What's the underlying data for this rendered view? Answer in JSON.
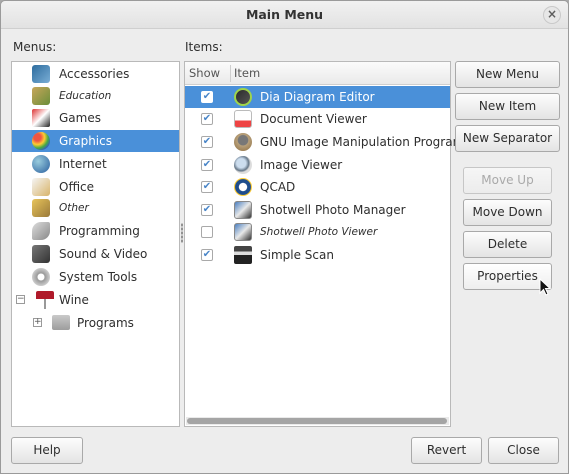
{
  "window": {
    "title": "Main Menu"
  },
  "labels": {
    "menus": "Menus:",
    "items": "Items:"
  },
  "menus": [
    {
      "label": "Accessories",
      "icon": "accessories-icon",
      "style": "normal",
      "selected": false
    },
    {
      "label": "Education",
      "icon": "education-icon",
      "style": "hidden",
      "selected": false
    },
    {
      "label": "Games",
      "icon": "games-icon",
      "style": "normal",
      "selected": false
    },
    {
      "label": "Graphics",
      "icon": "graphics-icon",
      "style": "normal",
      "selected": true
    },
    {
      "label": "Internet",
      "icon": "internet-icon",
      "style": "normal",
      "selected": false
    },
    {
      "label": "Office",
      "icon": "office-icon",
      "style": "normal",
      "selected": false
    },
    {
      "label": "Other",
      "icon": "other-icon",
      "style": "hidden",
      "selected": false
    },
    {
      "label": "Programming",
      "icon": "programming-icon",
      "style": "normal",
      "selected": false
    },
    {
      "label": "Sound & Video",
      "icon": "sound-video-icon",
      "style": "normal",
      "selected": false
    },
    {
      "label": "System Tools",
      "icon": "system-tools-icon",
      "style": "normal",
      "selected": false
    },
    {
      "label": "Wine",
      "icon": "wine-icon",
      "style": "normal",
      "selected": false,
      "expander": "collapse"
    },
    {
      "label": "Programs",
      "icon": "folder-icon",
      "style": "normal",
      "selected": false,
      "expander": "expand",
      "indent": true
    }
  ],
  "items_table": {
    "headers": {
      "show": "Show",
      "item": "Item"
    },
    "rows": [
      {
        "label": "Dia Diagram Editor",
        "show": true,
        "style": "normal",
        "icon": "dia-icon",
        "selected": true
      },
      {
        "label": "Document Viewer",
        "show": true,
        "style": "normal",
        "icon": "document-viewer-icon",
        "selected": false
      },
      {
        "label": "GNU Image Manipulation Program",
        "show": true,
        "style": "normal",
        "icon": "gimp-icon",
        "selected": false
      },
      {
        "label": "Image Viewer",
        "show": true,
        "style": "normal",
        "icon": "image-viewer-icon",
        "selected": false
      },
      {
        "label": "QCAD",
        "show": true,
        "style": "normal",
        "icon": "qcad-icon",
        "selected": false
      },
      {
        "label": "Shotwell Photo Manager",
        "show": true,
        "style": "normal",
        "icon": "shotwell-icon",
        "selected": false
      },
      {
        "label": "Shotwell Photo Viewer",
        "show": false,
        "style": "hidden",
        "icon": "shotwell-viewer-icon",
        "selected": false
      },
      {
        "label": "Simple Scan",
        "show": true,
        "style": "normal",
        "icon": "scanner-icon",
        "selected": false
      }
    ]
  },
  "buttons": {
    "new_menu": "New Menu",
    "new_item": "New Item",
    "new_separator": "New Separator",
    "move_up": "Move Up",
    "move_down": "Move Down",
    "delete": "Delete",
    "properties": "Properties",
    "help": "Help",
    "revert": "Revert",
    "close": "Close"
  },
  "colors": {
    "selection": "#4a90d9",
    "checkmark": "#4a86c8"
  }
}
